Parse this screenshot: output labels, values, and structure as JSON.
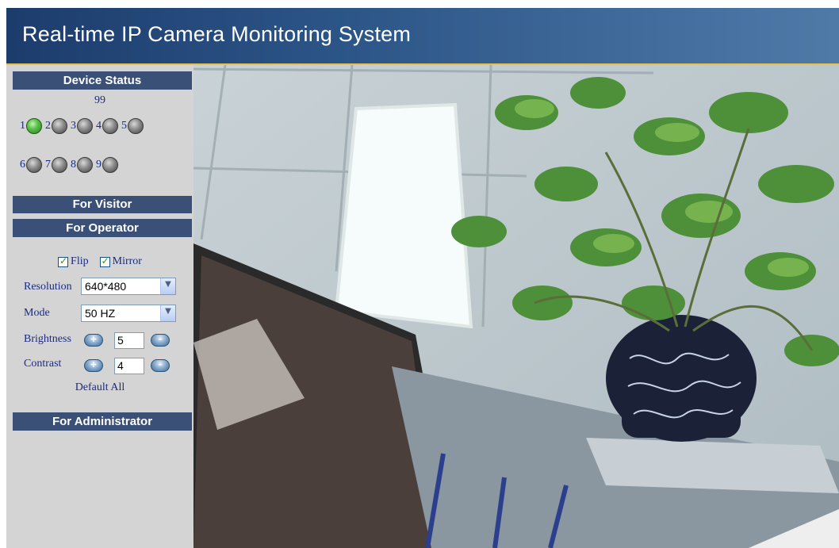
{
  "header": {
    "title": "Real-time IP Camera Monitoring System"
  },
  "sidebar": {
    "device_status": {
      "title": "Device Status",
      "count": "99",
      "devices": [
        {
          "num": "1",
          "state": "online"
        },
        {
          "num": "2",
          "state": "offline"
        },
        {
          "num": "3",
          "state": "offline"
        },
        {
          "num": "4",
          "state": "offline"
        },
        {
          "num": "5",
          "state": "offline"
        },
        {
          "num": "6",
          "state": "offline"
        },
        {
          "num": "7",
          "state": "offline"
        },
        {
          "num": "8",
          "state": "offline"
        },
        {
          "num": "9",
          "state": "offline"
        }
      ]
    },
    "visitor": {
      "title": "For Visitor"
    },
    "operator": {
      "title": "For Operator",
      "flip": {
        "label": "Flip",
        "checked": true
      },
      "mirror": {
        "label": "Mirror",
        "checked": true
      },
      "check_mark": "✓",
      "resolution": {
        "label": "Resolution",
        "value": "640*480"
      },
      "mode": {
        "label": "Mode",
        "value": "50 HZ"
      },
      "brightness": {
        "label": "Brightness",
        "value": "5"
      },
      "contrast": {
        "label": "Contrast",
        "value": "4"
      },
      "increase_symbol": "+",
      "decrease_symbol": "–",
      "dropdown_arrow": "▼",
      "default_all": "Default All"
    },
    "administrator": {
      "title": "For Administrator"
    }
  },
  "colors": {
    "header_gradient_start": "#1c3c6c",
    "header_gradient_end": "#4f7aa8",
    "header_underline": "#e8c14a",
    "panel_header": "#3b5077",
    "sidebar_bg": "#d4d4d4",
    "label_text": "#1b2a80",
    "led_online": "#59c24a",
    "led_offline": "#8a8a8a"
  }
}
